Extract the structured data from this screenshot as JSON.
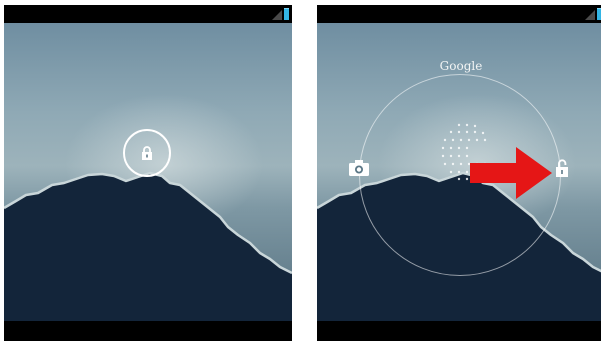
{
  "screens": [
    {
      "name": "lockscreen-locked",
      "handle_icon": "lock-closed-icon"
    },
    {
      "name": "lockscreen-unlocking",
      "top_target_label": "Google",
      "left_target_icon": "camera-icon",
      "right_target_icon": "lock-open-icon",
      "annotation": "red-arrow-right-icon"
    }
  ],
  "colors": {
    "status_battery": "#33b5e5",
    "arrow": "#e51616",
    "frame": "#000000",
    "ring": "#ffffff"
  }
}
